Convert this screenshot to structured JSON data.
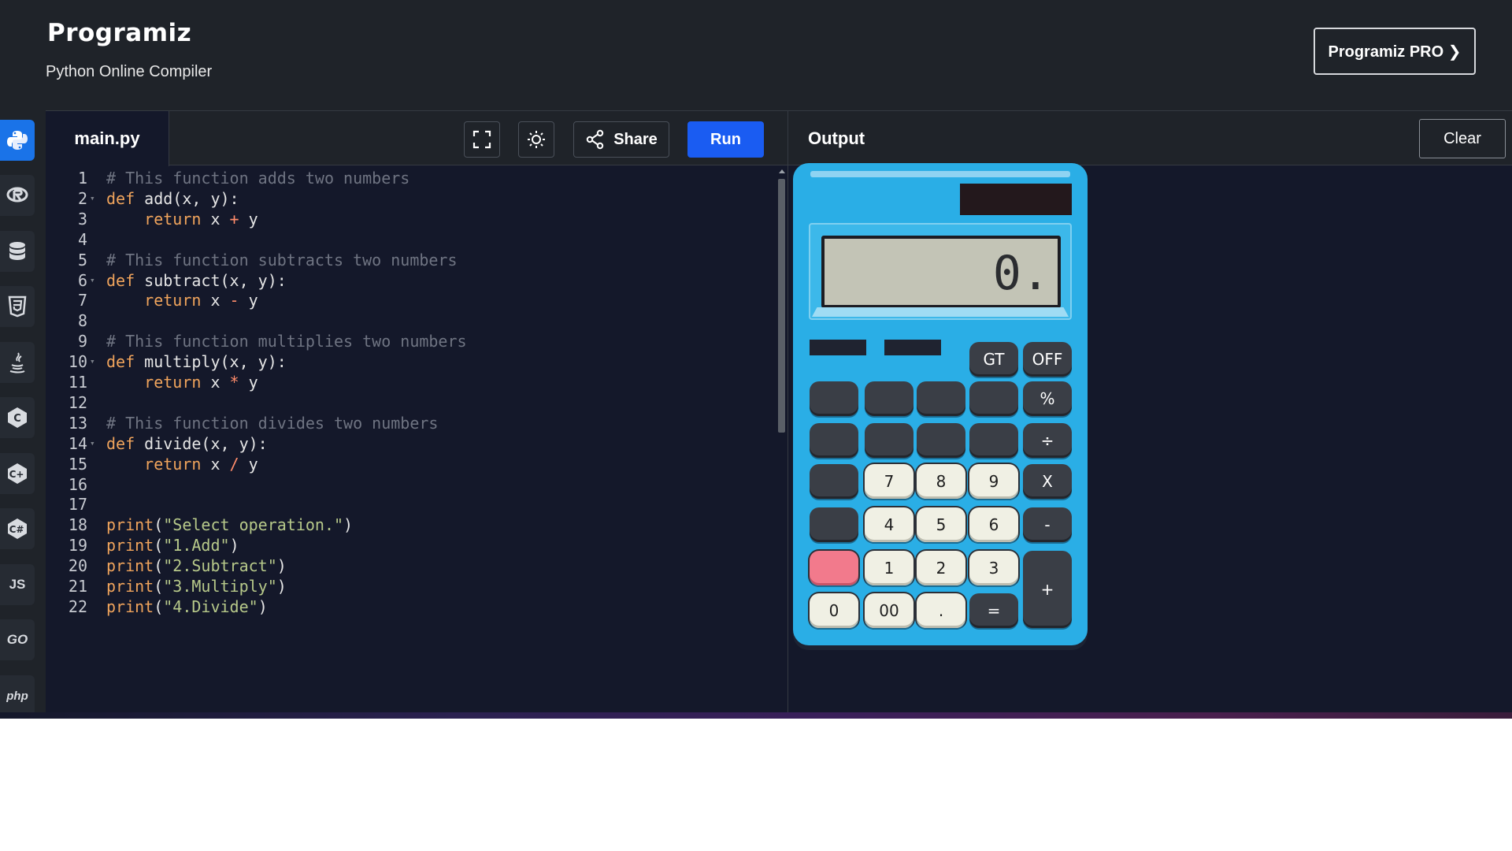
{
  "header": {
    "logo": "Programiz",
    "tagline": "Python Online Compiler",
    "pro_button": "Programiz PRO ❯"
  },
  "rail": {
    "items": [
      {
        "name": "python",
        "glyph": ""
      },
      {
        "name": "r",
        "glyph": "R"
      },
      {
        "name": "sql",
        "glyph": ""
      },
      {
        "name": "html",
        "glyph": "5"
      },
      {
        "name": "java",
        "glyph": "♨"
      },
      {
        "name": "c",
        "glyph": "C"
      },
      {
        "name": "cpp",
        "glyph": "C"
      },
      {
        "name": "csharp",
        "glyph": "C"
      },
      {
        "name": "js",
        "glyph": "JS"
      },
      {
        "name": "go",
        "glyph": "GO"
      },
      {
        "name": "php",
        "glyph": "php"
      }
    ]
  },
  "editor": {
    "file_tab": "main.py",
    "share_label": "Share",
    "run_label": "Run",
    "lines": [
      {
        "n": "1",
        "fold": false,
        "text": "# This function adds two numbers"
      },
      {
        "n": "2",
        "fold": true,
        "text": "def add(x, y):"
      },
      {
        "n": "3",
        "fold": false,
        "text": "    return x + y"
      },
      {
        "n": "4",
        "fold": false,
        "text": ""
      },
      {
        "n": "5",
        "fold": false,
        "text": "# This function subtracts two numbers"
      },
      {
        "n": "6",
        "fold": true,
        "text": "def subtract(x, y):"
      },
      {
        "n": "7",
        "fold": false,
        "text": "    return x - y"
      },
      {
        "n": "8",
        "fold": false,
        "text": ""
      },
      {
        "n": "9",
        "fold": false,
        "text": "# This function multiplies two numbers"
      },
      {
        "n": "10",
        "fold": true,
        "text": "def multiply(x, y):"
      },
      {
        "n": "11",
        "fold": false,
        "text": "    return x * y"
      },
      {
        "n": "12",
        "fold": false,
        "text": ""
      },
      {
        "n": "13",
        "fold": false,
        "text": "# This function divides two numbers"
      },
      {
        "n": "14",
        "fold": true,
        "text": "def divide(x, y):"
      },
      {
        "n": "15",
        "fold": false,
        "text": "    return x / y"
      },
      {
        "n": "16",
        "fold": false,
        "text": ""
      },
      {
        "n": "17",
        "fold": false,
        "text": ""
      },
      {
        "n": "18",
        "fold": false,
        "text": "print(\"Select operation.\")"
      },
      {
        "n": "19",
        "fold": false,
        "text": "print(\"1.Add\")"
      },
      {
        "n": "20",
        "fold": false,
        "text": "print(\"2.Subtract\")"
      },
      {
        "n": "21",
        "fold": false,
        "text": "print(\"3.Multiply\")"
      },
      {
        "n": "22",
        "fold": false,
        "text": "print(\"4.Divide\")"
      }
    ]
  },
  "output": {
    "title": "Output",
    "clear_label": "Clear"
  },
  "calculator": {
    "display": "0.",
    "keys": [
      {
        "id": "gt",
        "label": "GT",
        "style": "dark"
      },
      {
        "id": "off",
        "label": "OFF",
        "style": "dark"
      },
      {
        "id": "r1c1",
        "label": "",
        "style": "dark"
      },
      {
        "id": "r1c2",
        "label": "",
        "style": "dark"
      },
      {
        "id": "r1c3",
        "label": "",
        "style": "dark"
      },
      {
        "id": "r1c4",
        "label": "",
        "style": "dark"
      },
      {
        "id": "percent",
        "label": "%",
        "style": "dark"
      },
      {
        "id": "r2c1",
        "label": "",
        "style": "dark"
      },
      {
        "id": "r2c2",
        "label": "",
        "style": "dark"
      },
      {
        "id": "r2c3",
        "label": "",
        "style": "dark"
      },
      {
        "id": "r2c4",
        "label": "",
        "style": "dark"
      },
      {
        "id": "divide",
        "label": "÷",
        "style": "dark"
      },
      {
        "id": "r3c1",
        "label": "",
        "style": "dark"
      },
      {
        "id": "seven",
        "label": "7",
        "style": "light"
      },
      {
        "id": "eight",
        "label": "8",
        "style": "light"
      },
      {
        "id": "nine",
        "label": "9",
        "style": "light"
      },
      {
        "id": "multiply",
        "label": "X",
        "style": "dark"
      },
      {
        "id": "r4c1",
        "label": "",
        "style": "dark"
      },
      {
        "id": "four",
        "label": "4",
        "style": "light"
      },
      {
        "id": "five",
        "label": "5",
        "style": "light"
      },
      {
        "id": "six",
        "label": "6",
        "style": "light"
      },
      {
        "id": "minus",
        "label": "-",
        "style": "dark"
      },
      {
        "id": "clear-key",
        "label": "",
        "style": "pink"
      },
      {
        "id": "one",
        "label": "1",
        "style": "light"
      },
      {
        "id": "two",
        "label": "2",
        "style": "light"
      },
      {
        "id": "three",
        "label": "3",
        "style": "light"
      },
      {
        "id": "plus",
        "label": "+",
        "style": "dark"
      },
      {
        "id": "zero",
        "label": "0",
        "style": "light"
      },
      {
        "id": "double-zero",
        "label": "00",
        "style": "light"
      },
      {
        "id": "decimal",
        "label": ".",
        "style": "light"
      },
      {
        "id": "equals",
        "label": "=",
        "style": "dark"
      }
    ]
  },
  "colors": {
    "accent": "#1a5cf2",
    "header_bg": "#1f2329",
    "editor_bg": "#14182a",
    "calculator_body": "#2aaee6"
  }
}
